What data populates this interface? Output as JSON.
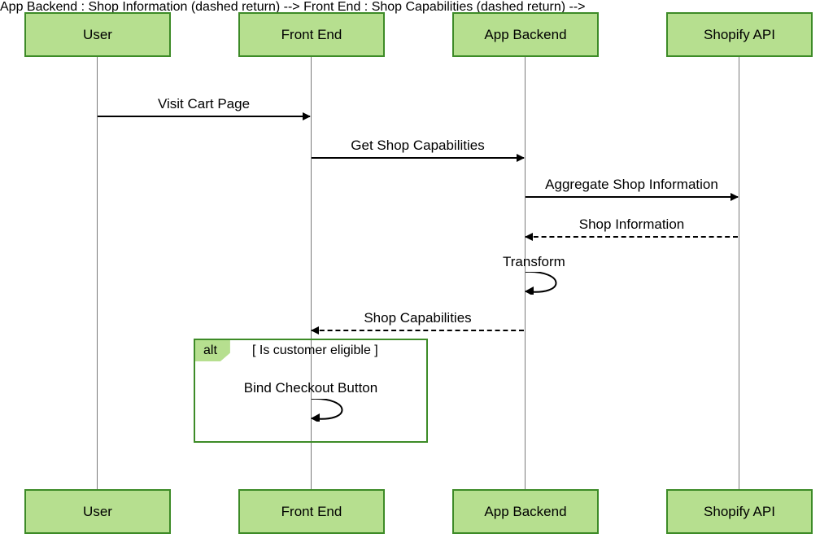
{
  "actors": {
    "user": "User",
    "frontend": "Front End",
    "backend": "App Backend",
    "shopify": "Shopify API"
  },
  "messages": {
    "m1": "Visit Cart Page",
    "m2": "Get Shop Capabilities",
    "m3": "Aggregate Shop Information",
    "m4": "Shop Information",
    "m5": "Transform",
    "m6": "Shop Capabilities",
    "m7": "Bind Checkout Button"
  },
  "alt": {
    "tag": "alt",
    "condition": "[ Is customer eligible ]"
  }
}
